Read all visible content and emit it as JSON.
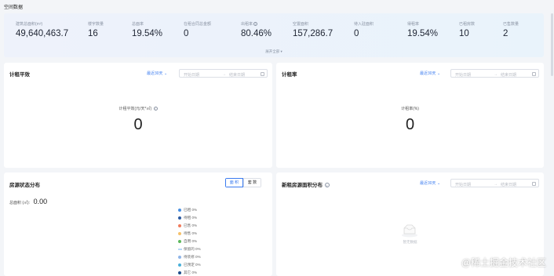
{
  "page": {
    "title": "空间数据"
  },
  "summary": {
    "stats": [
      {
        "label": "建筑总面积(m²)",
        "value": "49,640,463.7"
      },
      {
        "label": "楼宇数量",
        "value": "16"
      },
      {
        "label": "总面率",
        "value": "19.54%"
      },
      {
        "label": "在租合同总金额",
        "value": "0"
      },
      {
        "label": "出租率",
        "value": "80.46%"
      },
      {
        "label": "空置面积",
        "value": "157,286.7"
      },
      {
        "label": "待入驻面积",
        "value": "0"
      },
      {
        "label": "得租率",
        "value": "19.54%"
      },
      {
        "label": "已租房数",
        "value": "10"
      },
      {
        "label": "已售数量",
        "value": "2"
      }
    ],
    "expand_label": "展开全部 ▾"
  },
  "avg_rent_card": {
    "title": "计租平效",
    "range_label": "最近30天 ⌄",
    "start_placeholder": "开始日期",
    "arrow": "→",
    "end_placeholder": "结束日期",
    "metric_label": "计租平效(元/天*㎡)",
    "metric_value": "0"
  },
  "rent_rate_card": {
    "title": "计租率",
    "range_label": "最近30天 ⌄",
    "start_placeholder": "开始日期",
    "arrow": "→",
    "end_placeholder": "结束日期",
    "metric_label": "计租率(%)",
    "metric_value": "0"
  },
  "status_card": {
    "title": "房源状态分布",
    "toggle": [
      "面 积",
      "套 数"
    ],
    "total_label": "总面积 (㎡):",
    "total_value": "0.00",
    "legend": [
      {
        "label": "已租 0%",
        "color": "#4a90e2",
        "shape": "dot"
      },
      {
        "label": "待租 0%",
        "color": "#2c5aa0",
        "shape": "dot"
      },
      {
        "label": "已售 0%",
        "color": "#f07b5c",
        "shape": "dot"
      },
      {
        "label": "待售 0%",
        "color": "#f5c26b",
        "shape": "dot"
      },
      {
        "label": "自用 0%",
        "color": "#5cb85c",
        "shape": "dot"
      },
      {
        "label": "保留的 0%",
        "color": "#b7d6f5",
        "shape": "dash"
      },
      {
        "label": "待装修 0%",
        "color": "#8fb5e8",
        "shape": "dot"
      },
      {
        "label": "已预定 0%",
        "color": "#4ab0d9",
        "shape": "dot"
      },
      {
        "label": "其它 0%",
        "color": "#1f4e8c",
        "shape": "dot"
      }
    ]
  },
  "new_lease_card": {
    "title": "新租房源面积分布",
    "range_label": "最近30天 ⌄",
    "start_placeholder": "开始日期",
    "arrow": "→",
    "end_placeholder": "结束日期",
    "empty_label": "暂无数据"
  },
  "watermark": "@稀土掘金技术社区"
}
